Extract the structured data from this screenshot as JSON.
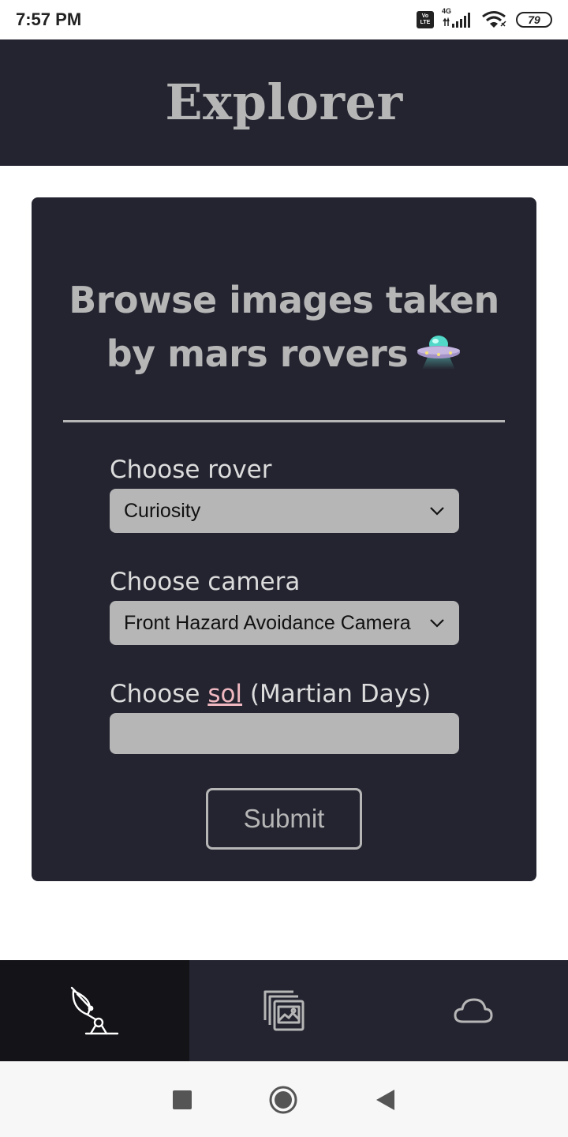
{
  "status_bar": {
    "time": "7:57 PM",
    "volte_line1": "Vo",
    "volte_line2": "LTE",
    "network": "4G",
    "battery": "79"
  },
  "header": {
    "title": "Explorer"
  },
  "card": {
    "heading_line1": "Browse images taken",
    "heading_line2": "by mars rovers",
    "heading_icon": "ufo-icon",
    "rover": {
      "label": "Choose rover",
      "selected": "Curiosity"
    },
    "camera": {
      "label": "Choose camera",
      "selected": "Front Hazard Avoidance Camera"
    },
    "sol": {
      "label_prefix": "Choose",
      "label_link": "sol",
      "label_suffix": "(Martian Days)",
      "value": "",
      "placeholder": ""
    },
    "submit_label": "Submit"
  },
  "bottom_nav": {
    "items": [
      {
        "icon": "satellite-dish-icon",
        "active": true
      },
      {
        "icon": "image-gallery-icon",
        "active": false
      },
      {
        "icon": "cloud-icon",
        "active": false
      }
    ]
  },
  "system_nav": {
    "icons": [
      "recents-icon",
      "home-icon",
      "back-icon"
    ]
  },
  "colors": {
    "header_bg": "#232430",
    "card_bg": "#232430",
    "text_muted": "#b6b6b6",
    "input_bg": "#b6b6b6",
    "link": "#f0b8c0",
    "nav_active": "#131318"
  }
}
